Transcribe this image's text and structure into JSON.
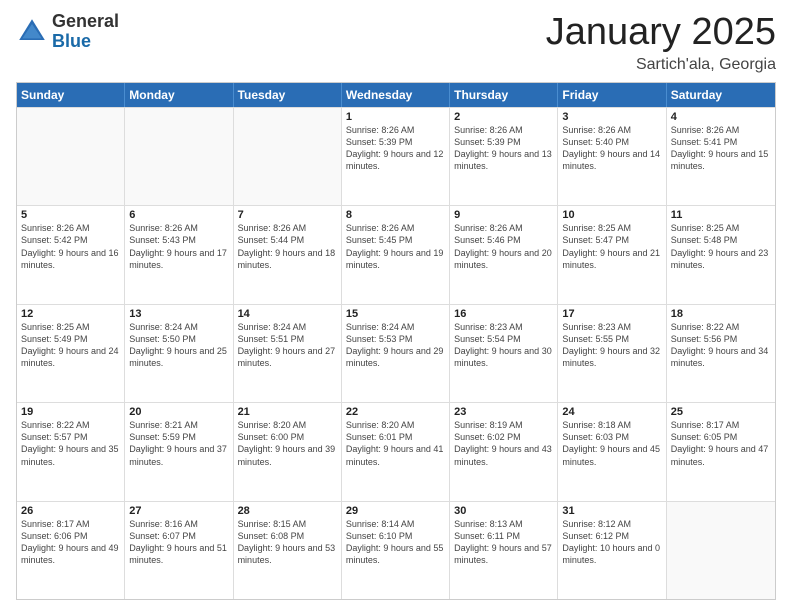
{
  "logo": {
    "general": "General",
    "blue": "Blue"
  },
  "header": {
    "month_year": "January 2025",
    "location": "Sartich'ala, Georgia"
  },
  "weekdays": [
    "Sunday",
    "Monday",
    "Tuesday",
    "Wednesday",
    "Thursday",
    "Friday",
    "Saturday"
  ],
  "rows": [
    [
      {
        "date": "",
        "sunrise": "",
        "sunset": "",
        "daylight": "",
        "empty": true
      },
      {
        "date": "",
        "sunrise": "",
        "sunset": "",
        "daylight": "",
        "empty": true
      },
      {
        "date": "",
        "sunrise": "",
        "sunset": "",
        "daylight": "",
        "empty": true
      },
      {
        "date": "1",
        "sunrise": "Sunrise: 8:26 AM",
        "sunset": "Sunset: 5:39 PM",
        "daylight": "Daylight: 9 hours and 12 minutes.",
        "empty": false
      },
      {
        "date": "2",
        "sunrise": "Sunrise: 8:26 AM",
        "sunset": "Sunset: 5:39 PM",
        "daylight": "Daylight: 9 hours and 13 minutes.",
        "empty": false
      },
      {
        "date": "3",
        "sunrise": "Sunrise: 8:26 AM",
        "sunset": "Sunset: 5:40 PM",
        "daylight": "Daylight: 9 hours and 14 minutes.",
        "empty": false
      },
      {
        "date": "4",
        "sunrise": "Sunrise: 8:26 AM",
        "sunset": "Sunset: 5:41 PM",
        "daylight": "Daylight: 9 hours and 15 minutes.",
        "empty": false
      }
    ],
    [
      {
        "date": "5",
        "sunrise": "Sunrise: 8:26 AM",
        "sunset": "Sunset: 5:42 PM",
        "daylight": "Daylight: 9 hours and 16 minutes.",
        "empty": false
      },
      {
        "date": "6",
        "sunrise": "Sunrise: 8:26 AM",
        "sunset": "Sunset: 5:43 PM",
        "daylight": "Daylight: 9 hours and 17 minutes.",
        "empty": false
      },
      {
        "date": "7",
        "sunrise": "Sunrise: 8:26 AM",
        "sunset": "Sunset: 5:44 PM",
        "daylight": "Daylight: 9 hours and 18 minutes.",
        "empty": false
      },
      {
        "date": "8",
        "sunrise": "Sunrise: 8:26 AM",
        "sunset": "Sunset: 5:45 PM",
        "daylight": "Daylight: 9 hours and 19 minutes.",
        "empty": false
      },
      {
        "date": "9",
        "sunrise": "Sunrise: 8:26 AM",
        "sunset": "Sunset: 5:46 PM",
        "daylight": "Daylight: 9 hours and 20 minutes.",
        "empty": false
      },
      {
        "date": "10",
        "sunrise": "Sunrise: 8:25 AM",
        "sunset": "Sunset: 5:47 PM",
        "daylight": "Daylight: 9 hours and 21 minutes.",
        "empty": false
      },
      {
        "date": "11",
        "sunrise": "Sunrise: 8:25 AM",
        "sunset": "Sunset: 5:48 PM",
        "daylight": "Daylight: 9 hours and 23 minutes.",
        "empty": false
      }
    ],
    [
      {
        "date": "12",
        "sunrise": "Sunrise: 8:25 AM",
        "sunset": "Sunset: 5:49 PM",
        "daylight": "Daylight: 9 hours and 24 minutes.",
        "empty": false
      },
      {
        "date": "13",
        "sunrise": "Sunrise: 8:24 AM",
        "sunset": "Sunset: 5:50 PM",
        "daylight": "Daylight: 9 hours and 25 minutes.",
        "empty": false
      },
      {
        "date": "14",
        "sunrise": "Sunrise: 8:24 AM",
        "sunset": "Sunset: 5:51 PM",
        "daylight": "Daylight: 9 hours and 27 minutes.",
        "empty": false
      },
      {
        "date": "15",
        "sunrise": "Sunrise: 8:24 AM",
        "sunset": "Sunset: 5:53 PM",
        "daylight": "Daylight: 9 hours and 29 minutes.",
        "empty": false
      },
      {
        "date": "16",
        "sunrise": "Sunrise: 8:23 AM",
        "sunset": "Sunset: 5:54 PM",
        "daylight": "Daylight: 9 hours and 30 minutes.",
        "empty": false
      },
      {
        "date": "17",
        "sunrise": "Sunrise: 8:23 AM",
        "sunset": "Sunset: 5:55 PM",
        "daylight": "Daylight: 9 hours and 32 minutes.",
        "empty": false
      },
      {
        "date": "18",
        "sunrise": "Sunrise: 8:22 AM",
        "sunset": "Sunset: 5:56 PM",
        "daylight": "Daylight: 9 hours and 34 minutes.",
        "empty": false
      }
    ],
    [
      {
        "date": "19",
        "sunrise": "Sunrise: 8:22 AM",
        "sunset": "Sunset: 5:57 PM",
        "daylight": "Daylight: 9 hours and 35 minutes.",
        "empty": false
      },
      {
        "date": "20",
        "sunrise": "Sunrise: 8:21 AM",
        "sunset": "Sunset: 5:59 PM",
        "daylight": "Daylight: 9 hours and 37 minutes.",
        "empty": false
      },
      {
        "date": "21",
        "sunrise": "Sunrise: 8:20 AM",
        "sunset": "Sunset: 6:00 PM",
        "daylight": "Daylight: 9 hours and 39 minutes.",
        "empty": false
      },
      {
        "date": "22",
        "sunrise": "Sunrise: 8:20 AM",
        "sunset": "Sunset: 6:01 PM",
        "daylight": "Daylight: 9 hours and 41 minutes.",
        "empty": false
      },
      {
        "date": "23",
        "sunrise": "Sunrise: 8:19 AM",
        "sunset": "Sunset: 6:02 PM",
        "daylight": "Daylight: 9 hours and 43 minutes.",
        "empty": false
      },
      {
        "date": "24",
        "sunrise": "Sunrise: 8:18 AM",
        "sunset": "Sunset: 6:03 PM",
        "daylight": "Daylight: 9 hours and 45 minutes.",
        "empty": false
      },
      {
        "date": "25",
        "sunrise": "Sunrise: 8:17 AM",
        "sunset": "Sunset: 6:05 PM",
        "daylight": "Daylight: 9 hours and 47 minutes.",
        "empty": false
      }
    ],
    [
      {
        "date": "26",
        "sunrise": "Sunrise: 8:17 AM",
        "sunset": "Sunset: 6:06 PM",
        "daylight": "Daylight: 9 hours and 49 minutes.",
        "empty": false
      },
      {
        "date": "27",
        "sunrise": "Sunrise: 8:16 AM",
        "sunset": "Sunset: 6:07 PM",
        "daylight": "Daylight: 9 hours and 51 minutes.",
        "empty": false
      },
      {
        "date": "28",
        "sunrise": "Sunrise: 8:15 AM",
        "sunset": "Sunset: 6:08 PM",
        "daylight": "Daylight: 9 hours and 53 minutes.",
        "empty": false
      },
      {
        "date": "29",
        "sunrise": "Sunrise: 8:14 AM",
        "sunset": "Sunset: 6:10 PM",
        "daylight": "Daylight: 9 hours and 55 minutes.",
        "empty": false
      },
      {
        "date": "30",
        "sunrise": "Sunrise: 8:13 AM",
        "sunset": "Sunset: 6:11 PM",
        "daylight": "Daylight: 9 hours and 57 minutes.",
        "empty": false
      },
      {
        "date": "31",
        "sunrise": "Sunrise: 8:12 AM",
        "sunset": "Sunset: 6:12 PM",
        "daylight": "Daylight: 10 hours and 0 minutes.",
        "empty": false
      },
      {
        "date": "",
        "sunrise": "",
        "sunset": "",
        "daylight": "",
        "empty": true
      }
    ]
  ]
}
